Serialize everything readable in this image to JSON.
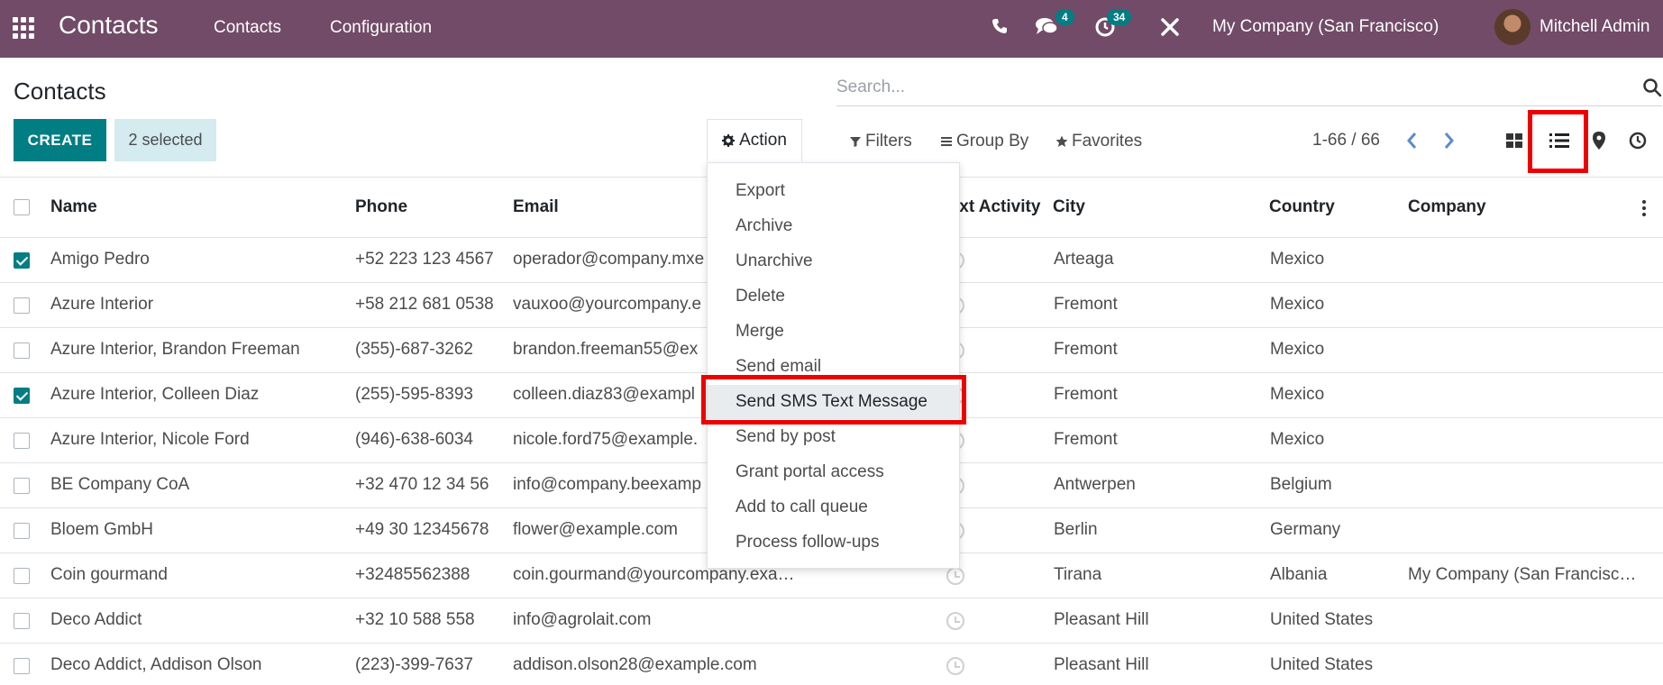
{
  "navbar": {
    "brand": "Contacts",
    "menu": [
      "Contacts",
      "Configuration"
    ],
    "messages_count": "4",
    "activities_count": "34",
    "company": "My Company (San Francisco)",
    "user": "Mitchell Admin",
    "accent_color": "#714b67"
  },
  "page": {
    "title": "Contacts",
    "search_placeholder": "Search...",
    "create_label": "CREATE",
    "selected_label": "2 selected",
    "action_label": "Action",
    "filters_label": "Filters",
    "groupby_label": "Group By",
    "favorites_label": "Favorites",
    "pager": "1-66 / 66",
    "primary_color": "#017e84"
  },
  "columns": [
    "Name",
    "Phone",
    "Email",
    "Next Activity",
    "City",
    "Country",
    "Company"
  ],
  "rows": [
    {
      "checked": true,
      "name": "Amigo Pedro",
      "phone": "+52 223 123 4567",
      "email": "operador@company.mxe",
      "city": "Arteaga",
      "country": "Mexico",
      "company": ""
    },
    {
      "checked": false,
      "name": "Azure Interior",
      "phone": "+58 212 681 0538",
      "email": "vauxoo@yourcompany.e",
      "city": "Fremont",
      "country": "Mexico",
      "company": ""
    },
    {
      "checked": false,
      "name": "Azure Interior, Brandon Freeman",
      "phone": "(355)-687-3262",
      "email": "brandon.freeman55@ex",
      "city": "Fremont",
      "country": "Mexico",
      "company": ""
    },
    {
      "checked": true,
      "name": "Azure Interior, Colleen Diaz",
      "phone": "(255)-595-8393",
      "email": "colleen.diaz83@exampl",
      "city": "Fremont",
      "country": "Mexico",
      "company": ""
    },
    {
      "checked": false,
      "name": "Azure Interior, Nicole Ford",
      "phone": "(946)-638-6034",
      "email": "nicole.ford75@example.",
      "city": "Fremont",
      "country": "Mexico",
      "company": ""
    },
    {
      "checked": false,
      "name": "BE Company CoA",
      "phone": "+32 470 12 34 56",
      "email": "info@company.beexamp",
      "city": "Antwerpen",
      "country": "Belgium",
      "company": ""
    },
    {
      "checked": false,
      "name": "Bloem GmbH",
      "phone": "+49 30 12345678",
      "email": "flower@example.com",
      "city": "Berlin",
      "country": "Germany",
      "company": ""
    },
    {
      "checked": false,
      "name": "Coin gourmand",
      "phone": "+32485562388",
      "email": "coin.gourmand@yourcompany.exa…",
      "city": "Tirana",
      "country": "Albania",
      "company": "My Company (San Francisc…"
    },
    {
      "checked": false,
      "name": "Deco Addict",
      "phone": "+32 10 588 558",
      "email": "info@agrolait.com",
      "city": "Pleasant Hill",
      "country": "United States",
      "company": ""
    },
    {
      "checked": false,
      "name": "Deco Addict, Addison Olson",
      "phone": "(223)-399-7637",
      "email": "addison.olson28@example.com",
      "city": "Pleasant Hill",
      "country": "United States",
      "company": ""
    }
  ],
  "action_menu": [
    "Export",
    "Archive",
    "Unarchive",
    "Delete",
    "Merge",
    "Send email",
    "Send SMS Text Message",
    "Send by post",
    "Grant portal access",
    "Add to call queue",
    "Process follow-ups"
  ],
  "highlight_color": "#ee0000"
}
